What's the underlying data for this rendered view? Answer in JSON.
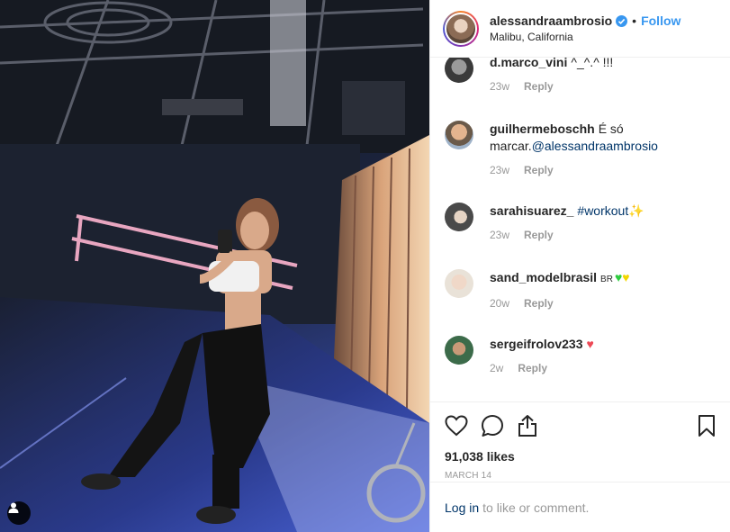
{
  "post": {
    "username": "alessandraambrosio",
    "separator": "•",
    "follow_label": "Follow",
    "location": "Malibu, California",
    "verified": true
  },
  "comments": [
    {
      "username": "d.marco_vini",
      "text": "^_^.^ !!!",
      "time": "23w",
      "reply": "Reply"
    },
    {
      "username": "guilhermeboschh",
      "text": "É só marcar.",
      "mention": "@alessandraambrosio",
      "time": "23w",
      "reply": "Reply"
    },
    {
      "username": "sarahisuarez_",
      "hashtag": "#workout",
      "emoji": "✨",
      "time": "23w",
      "reply": "Reply"
    },
    {
      "username": "sand_modelbrasil",
      "flag": "BR",
      "emoji1": "♥",
      "emoji2": "♥",
      "time": "20w",
      "reply": "Reply"
    },
    {
      "username": "sergeifrolov233",
      "emoji": "♥",
      "time": "2w",
      "reply": "Reply"
    }
  ],
  "actions": {
    "likes": "91,038 likes",
    "date": "MARCH 14"
  },
  "footer": {
    "login_link": "Log in",
    "login_text": "to like or comment."
  },
  "colors": {
    "link": "#3897f0",
    "mention": "#003569",
    "muted": "#999999",
    "like_red": "#ed4956"
  }
}
